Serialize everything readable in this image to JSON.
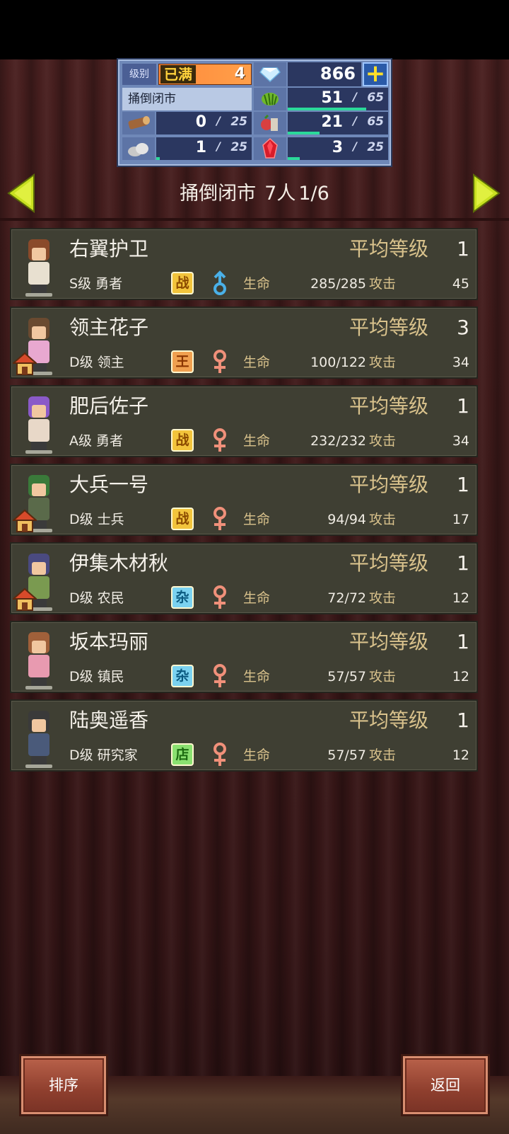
{
  "resources": {
    "level_label": "级别",
    "level_max_tag": "已满",
    "level_value": "4",
    "gems": "866",
    "town_name": "捅倒闭市",
    "grass": {
      "current": "51",
      "max": "65",
      "fill": 0.78
    },
    "wood": {
      "current": "0",
      "max": "25",
      "fill": 0.0
    },
    "food": {
      "current": "21",
      "max": "65",
      "fill": 0.32
    },
    "stone": {
      "current": "1",
      "max": "25",
      "fill": 0.04
    },
    "ruby": {
      "current": "3",
      "max": "25",
      "fill": 0.12
    }
  },
  "header": {
    "town": "捅倒闭市",
    "population": "7人",
    "page": "1/6"
  },
  "labels": {
    "avg_level": "平均等级",
    "hp": "生命",
    "attack": "攻击"
  },
  "characters": [
    {
      "name": "右翼护卫",
      "level": "1",
      "rank": "S级 勇者",
      "type": "战",
      "gender": "male",
      "hp": "285/285",
      "attack": "45",
      "house": false
    },
    {
      "name": "领主花子",
      "level": "3",
      "rank": "D级 领主",
      "type": "王",
      "gender": "female",
      "hp": "100/122",
      "attack": "34",
      "house": true
    },
    {
      "name": "肥后佐子",
      "level": "1",
      "rank": "A级 勇者",
      "type": "战",
      "gender": "female",
      "hp": "232/232",
      "attack": "34",
      "house": false
    },
    {
      "name": "大兵一号",
      "level": "1",
      "rank": "D级 士兵",
      "type": "战",
      "gender": "female",
      "hp": "94/94",
      "attack": "17",
      "house": true
    },
    {
      "name": "伊集木材秋",
      "level": "1",
      "rank": "D级 农民",
      "type": "杂",
      "gender": "female",
      "hp": "72/72",
      "attack": "12",
      "house": true
    },
    {
      "name": "坂本玛丽",
      "level": "1",
      "rank": "D级 镇民",
      "type": "杂",
      "gender": "female",
      "hp": "57/57",
      "attack": "12",
      "house": false
    },
    {
      "name": "陆奥遥香",
      "level": "1",
      "rank": "D级 研究家",
      "type": "店",
      "gender": "female",
      "hp": "57/57",
      "attack": "12",
      "house": false
    }
  ],
  "buttons": {
    "sort": "排序",
    "back": "返回"
  },
  "colors": {
    "card_bg": "#3f3f33",
    "gold_text": "#d9c28c",
    "bar_fill": "#2bd99a",
    "arrow": "#c8e020"
  }
}
